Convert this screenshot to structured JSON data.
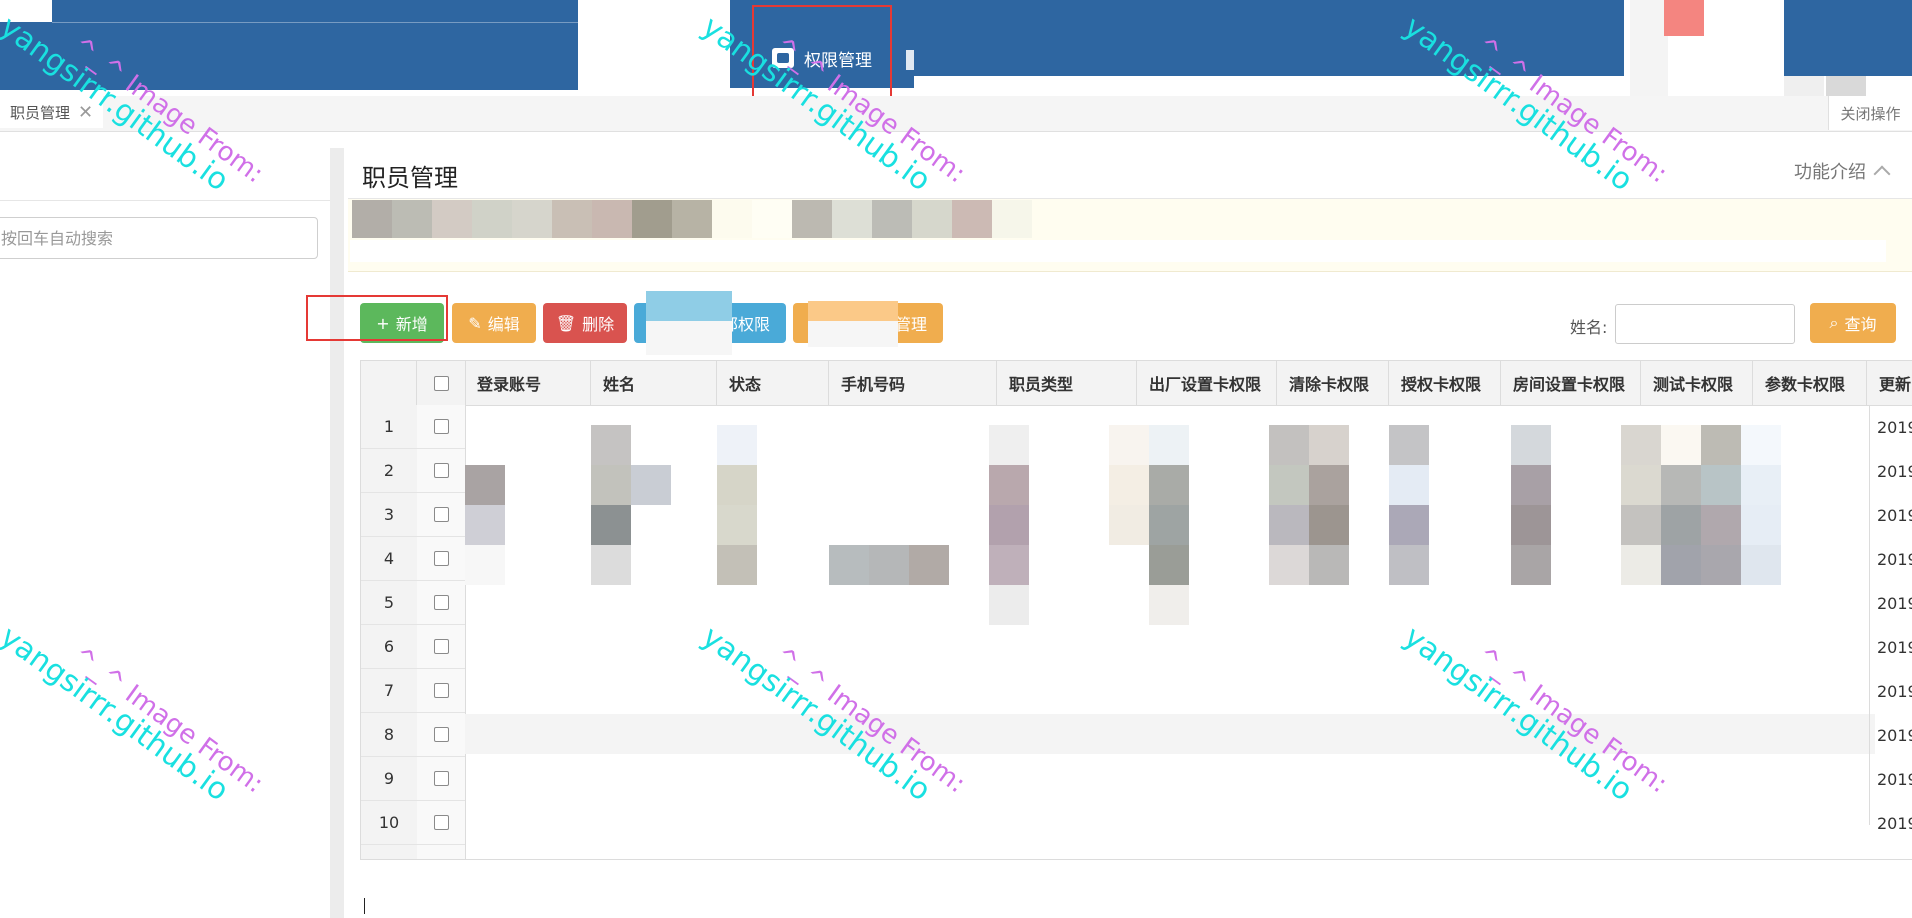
{
  "header": {
    "active_nav_label": "权限管理"
  },
  "tabs": {
    "open_tab_label": "职员管理",
    "close_symbol": "✕",
    "tools_label": "关闭操作"
  },
  "sidebar": {
    "search_placeholder": "按回车自动搜索"
  },
  "panel": {
    "title": "职员管理",
    "help_label": "功能介绍"
  },
  "toolbar": {
    "add_label": "新增",
    "edit_label": "编辑",
    "delete_label": "删除",
    "permission_label_visible": "部权限",
    "manage_label_visible": "管理",
    "search_label": "姓名:",
    "search_value": "",
    "query_label": "查询"
  },
  "table": {
    "columns": [
      "登录账号",
      "姓名",
      "状态",
      "手机号码",
      "职员类型",
      "出厂设置卡权限",
      "清除卡权限",
      "授权卡权限",
      "房间设置卡权限",
      "测试卡权限",
      "参数卡权限",
      "更新"
    ],
    "row_numbers": [
      "1",
      "2",
      "3",
      "4",
      "5",
      "6",
      "7",
      "8",
      "9",
      "10"
    ],
    "updated_prefix": "2019"
  },
  "watermark": {
    "line1": "^_^ Image From:",
    "line2": "yangsirrr.github.io"
  },
  "colors": {
    "header_blue": "#2e66a1",
    "btn_green": "#5cb85c",
    "btn_orange": "#f0ad4e",
    "btn_red": "#d9534f",
    "btn_blue": "#4aaad8",
    "highlight_red": "#e53935"
  }
}
